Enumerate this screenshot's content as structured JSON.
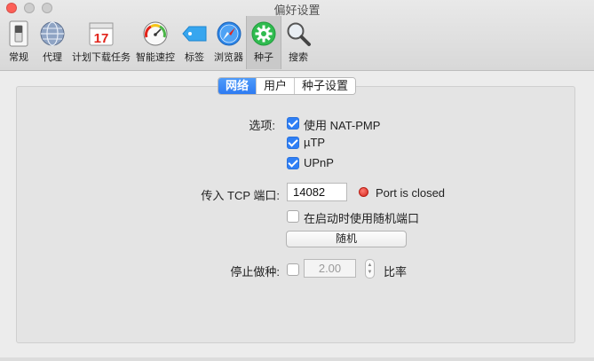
{
  "window": {
    "title": "偏好设置",
    "traffic_colors": [
      "#fd5f57",
      "#cdcdcd",
      "#cdcdcd"
    ]
  },
  "toolbar": {
    "items": [
      {
        "label": "常规",
        "icon": "general-switch-icon"
      },
      {
        "label": "代理",
        "icon": "globe-icon"
      },
      {
        "label": "计划下载任务",
        "icon": "calendar-icon",
        "icon_text": "17"
      },
      {
        "label": "智能速控",
        "icon": "speedometer-icon"
      },
      {
        "label": "标签",
        "icon": "tag-icon"
      },
      {
        "label": "浏览器",
        "icon": "compass-icon"
      },
      {
        "label": "种子",
        "icon": "gear-icon",
        "selected": true
      },
      {
        "label": "搜索",
        "icon": "magnifier-icon"
      }
    ]
  },
  "tabs": [
    {
      "label": "网络",
      "active": true
    },
    {
      "label": "用户",
      "active": false
    },
    {
      "label": "种子设置",
      "active": false
    }
  ],
  "network": {
    "options_label": "选项:",
    "nat_pmp": {
      "label": "使用 NAT-PMP",
      "checked": true
    },
    "utp": {
      "label": "µTP",
      "checked": true
    },
    "upnp": {
      "label": "UPnP",
      "checked": true
    },
    "tcp_port_label": "传入 TCP 端口:",
    "tcp_port_value": "14082",
    "port_status": "Port is closed",
    "port_status_color": "#d3241b",
    "random_port": {
      "label": "在启动时使用随机端口",
      "checked": false
    },
    "random_button": "随机",
    "stop_seeding_label": "停止做种:",
    "stop_seeding": {
      "checked": false
    },
    "ratio_value": "2.00",
    "ratio_label": "比率"
  }
}
